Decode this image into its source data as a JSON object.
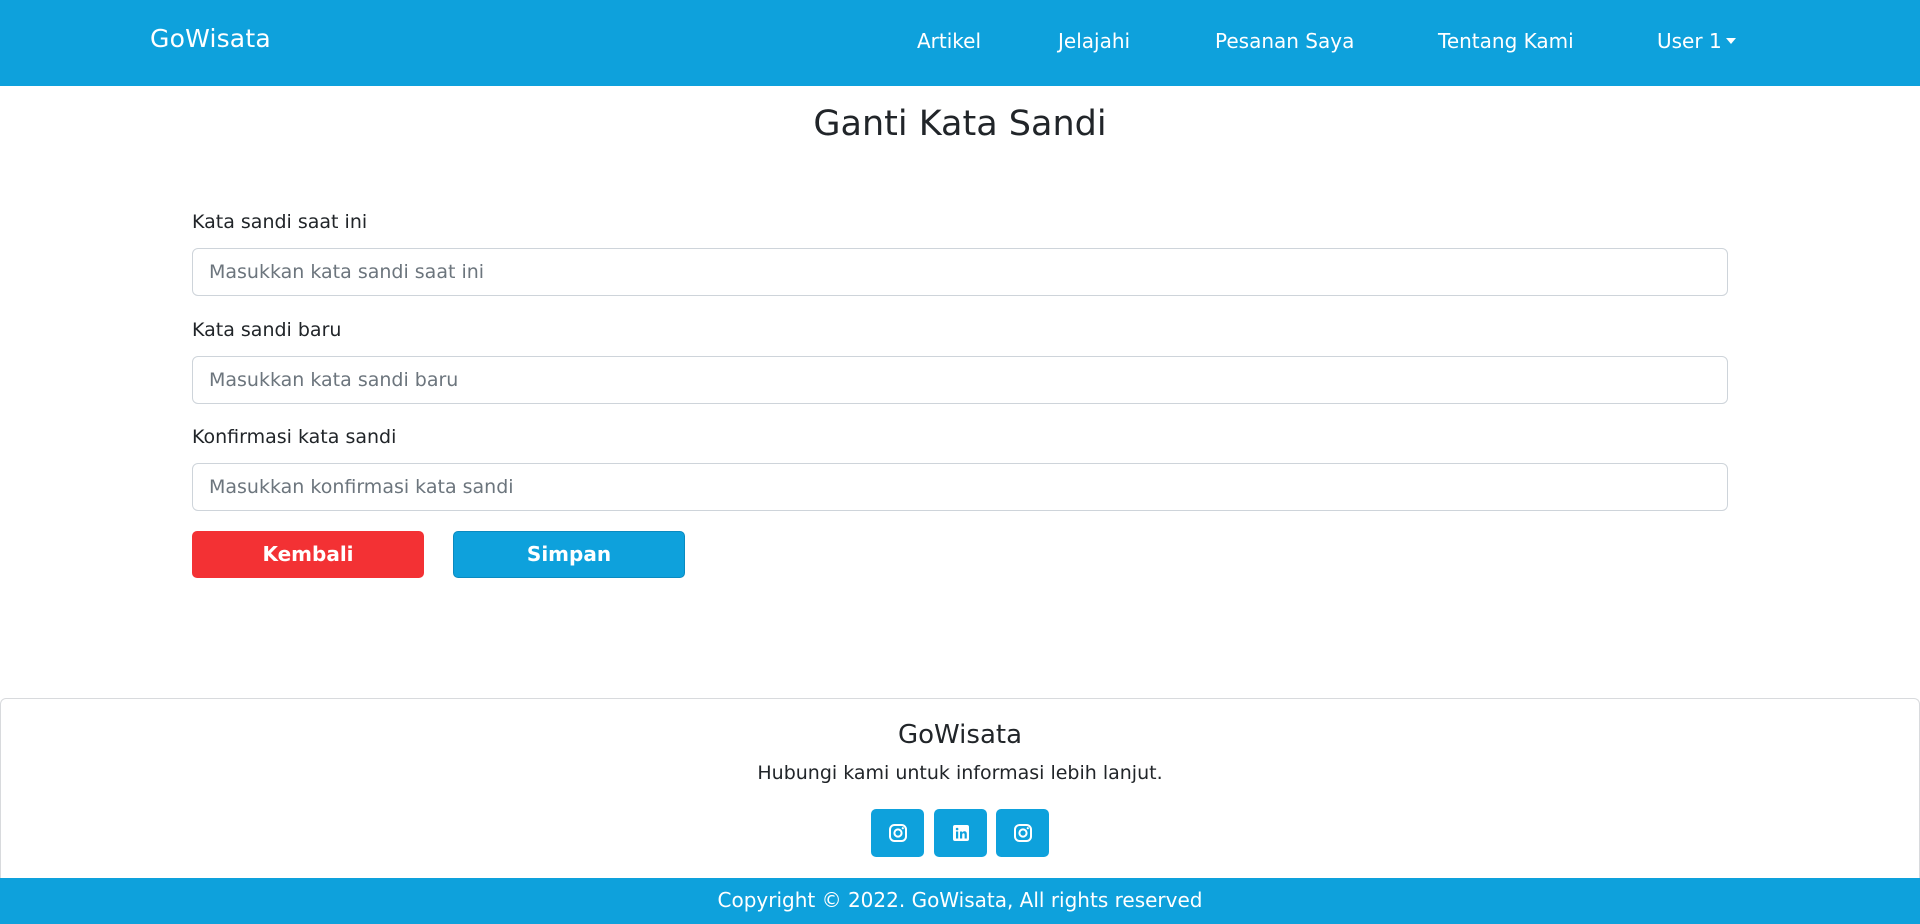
{
  "navbar": {
    "brand": "GoWisata",
    "links": [
      "Artikel",
      "Jelajahi",
      "Pesanan Saya",
      "Tentang Kami"
    ],
    "user_menu": "User 1",
    "background_color": "#0ea1dc"
  },
  "page": {
    "title": "Ganti Kata Sandi"
  },
  "form": {
    "current_password": {
      "label": "Kata sandi saat ini",
      "placeholder": "Masukkan kata sandi saat ini",
      "value": ""
    },
    "new_password": {
      "label": "Kata sandi baru",
      "placeholder": "Masukkan kata sandi baru",
      "value": ""
    },
    "confirm_password": {
      "label": "Konfirmasi kata sandi",
      "placeholder": "Masukkan konfirmasi kata sandi",
      "value": ""
    },
    "back_button": "Kembali",
    "save_button": "Simpan",
    "back_color": "#f33134",
    "save_color": "#0ea1dc"
  },
  "footer": {
    "title": "GoWisata",
    "subtitle": "Hubungi kami untuk informasi lebih lanjut.",
    "social_icons": [
      "instagram-icon",
      "linkedin-icon",
      "instagram-icon"
    ],
    "copyright": "Copyright © 2022. GoWisata, All rights reserved"
  }
}
